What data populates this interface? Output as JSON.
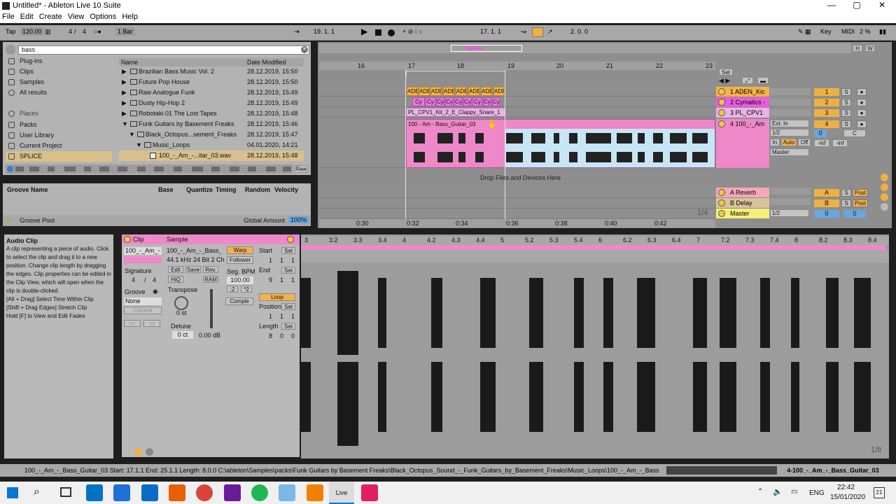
{
  "window": {
    "title": "Untitled* - Ableton Live 10 Suite",
    "min": "—",
    "max": "▢",
    "close": "✕"
  },
  "menu": [
    "File",
    "Edit",
    "Create",
    "View",
    "Options",
    "Help"
  ],
  "control": {
    "tap": "Tap",
    "tempo": "120.00",
    "time_sig_num": "4",
    "time_sig_den": "4",
    "quantize": "1 Bar",
    "position": "19.  1.  1",
    "loop_start": "17.  1.  1",
    "loop_length": "2.  0.  0",
    "key": "Key",
    "midi": "MIDI",
    "cpu": "2 %",
    "dots": "○●"
  },
  "browser": {
    "search_value": "bass",
    "places_header": "Places",
    "categories": [
      "Plug-ins",
      "Clips",
      "Samples",
      "All results"
    ],
    "places": [
      "Packs",
      "User Library",
      "Current Project",
      "SPLICE"
    ],
    "columns": {
      "name": "Name",
      "date": "Date Modified"
    },
    "files": [
      {
        "name": "Brazilian Bass Music Vol. 2",
        "date": "28.12.2019, 15:50"
      },
      {
        "name": "Future Pop House",
        "date": "28.12.2019, 15:50"
      },
      {
        "name": "Raw Analogue Funk",
        "date": "28.12.2019, 15:49"
      },
      {
        "name": "Dusty Hip-Hop 2",
        "date": "28.12.2019, 15:49"
      },
      {
        "name": "Robotaki 01 The Lost Tapes",
        "date": "28.12.2019, 15:48"
      },
      {
        "name": "Funk Guitars by Basement Freaks",
        "date": "28.12.2019, 15:46"
      },
      {
        "name": "Black_Octopus...sement_Freaks",
        "date": "28.12.2019, 15:47"
      },
      {
        "name": "Music_Loops",
        "date": "04.01.2020, 14:21"
      },
      {
        "name": "100_-_Am_-...itar_03.wav",
        "date": "28.12.2019, 15:48"
      }
    ],
    "raw": "Raw"
  },
  "groove": {
    "cols": [
      "Groove Name",
      "Base",
      "Quantize",
      "Timing",
      "Random",
      "Velocity"
    ],
    "pool": "Groove Pool",
    "global_label": "Global Amount",
    "global_value": "100%"
  },
  "arrangement": {
    "ruler": [
      "16",
      "17",
      "18",
      "19",
      "20",
      "21",
      "22",
      "23"
    ],
    "times": [
      "0:30",
      "0:32",
      "0:34",
      "0:36",
      "0:38",
      "0:40",
      "0:42"
    ],
    "set": "Set",
    "drop": "Drop Files and Devices Here",
    "fraction": "1/4",
    "tracks": [
      {
        "name": "1 ADEN_Kic",
        "num": "1",
        "color": "#f4b24a"
      },
      {
        "name": "2 Cymatics -",
        "num": "2",
        "color": "#ea5be0"
      },
      {
        "name": "3 PL_CPV1",
        "num": "3",
        "color": "#e8b3e6"
      },
      {
        "name": "4 100_-_Am",
        "num": "4",
        "color": "#ee88c8"
      }
    ],
    "returns": [
      {
        "name": "A Reverb",
        "num": "A",
        "color": "#f7a8b8"
      },
      {
        "name": "B Delay",
        "num": "B",
        "color": "#d8c49a"
      },
      {
        "name": "Master",
        "num": "0",
        "color": "#f5f07a"
      }
    ],
    "clip_labels": {
      "kick": "ADE",
      "cym": "Cy",
      "snare": "PL_CPV1_Kit_2_E_Clappy_Snare_1",
      "bass": "100 - Am - Bass_Guitar_03"
    },
    "io": {
      "ext_in": "Ext. In",
      "channel": "1/2",
      "in": "In",
      "auto": "Auto",
      "off": "Off",
      "master": "Master",
      "inf1": "-inf",
      "inf2": "-inf",
      "zero": "0",
      "c": "C",
      "half": "1/2",
      "post": "Post",
      "s": "S"
    }
  },
  "info": {
    "title": "Audio Clip",
    "text": "A clip representing a piece of audio. Click to select the clip and drag it to a new position. Change clip length by dragging the edges. Clip properties can be edited in the Clip View, which will open when the clip is double-clicked.",
    "k1": "[Alt + Drag] Select Time Within Clip",
    "k2": "[Shift + Drag Edges] Stretch Clip",
    "k3": "Hold [F] to View and Edit Fades"
  },
  "clipview": {
    "clip": "Clip",
    "clipname": "100_-_Am_-",
    "signature": "Signature",
    "sig_num": "4",
    "sig_den": "4",
    "groove": "Groove",
    "groove_val": "None",
    "commit": "Commit",
    "sample": "Sample",
    "sample_name": "100_-_Am_-_Bass_",
    "sample_info": "44.1 kHz 24 Bit 2 Ch",
    "edit": "Edit",
    "save": "Save",
    "rev": "Rev.",
    "hiq": "HiQ",
    "ram": "RAM",
    "transpose": "Transpose",
    "transpose_val": "0 st",
    "detune": "Detune",
    "detune_val": "0 ct",
    "gain": "0.00 dB",
    "warp": "Warp",
    "follower": "Follower",
    "seg_bpm": "Seg. BPM",
    "bpm": "100.00",
    "half": ":2",
    "dbl": "*2",
    "mode": "Comple",
    "start": "Start",
    "set": "Set",
    "start_vals": [
      "1",
      "1",
      "1"
    ],
    "end": "End",
    "end_vals": [
      "9",
      "1",
      "1"
    ],
    "loop": "Loop",
    "position": "Position",
    "pos_vals": [
      "1",
      "1",
      "1"
    ],
    "length": "Length",
    "len_vals": [
      "8",
      "0",
      "0"
    ]
  },
  "sample_ruler": [
    "3",
    "3.2",
    "3.3",
    "3.4",
    "4",
    "4.2",
    "4.3",
    "4.4",
    "5",
    "5.2",
    "5.3",
    "5.4",
    "6",
    "6.2",
    "6.3",
    "6.4",
    "7",
    "7.2",
    "7.3",
    "7.4",
    "8",
    "8.2",
    "8.3",
    "8.4"
  ],
  "sample_fraction": "1/8",
  "status": {
    "text": "100_-_Am_-_Bass_Guitar_03  Start: 17.1.1  End: 25.1.1  Length: 8.0.0  C:\\ableton\\Samples\\packs\\Funk Guitars by Basement Freaks\\Black_Octopus_Sound_-_Funk_Guitars_by_Basement_Freaks\\Music_Loops\\100_-_Am_-_Bass_Guita",
    "track": "4-100_-_Am_-_Bass_Guitar_03"
  },
  "taskbar": {
    "time": "22:42",
    "date": "15/01/2020",
    "lang": "ENG",
    "live": "Live",
    "notif": "21"
  }
}
